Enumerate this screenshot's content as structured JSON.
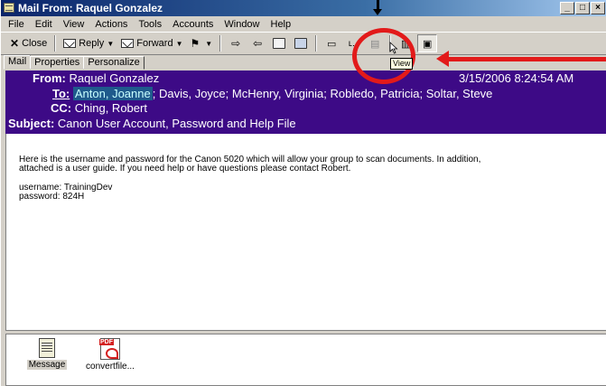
{
  "window": {
    "title": "Mail From: Raquel Gonzalez",
    "controls": [
      "_",
      "□",
      "×"
    ]
  },
  "menubar": [
    "File",
    "Edit",
    "View",
    "Actions",
    "Tools",
    "Accounts",
    "Window",
    "Help"
  ],
  "toolbar": {
    "close_label": "Close",
    "reply_label": "Reply",
    "forward_label": "Forward",
    "tooltip": "View"
  },
  "tabs": [
    "Mail",
    "Properties",
    "Personalize"
  ],
  "header": {
    "from_label": "From:",
    "from_value": "Raquel Gonzalez",
    "date": "3/15/2006 8:24:54 AM",
    "to_label": "To:",
    "to_first": "Anton, Joanne",
    "to_rest": "; Davis, Joyce; McHenry, Virginia; Robledo, Patricia; Soltar, Steve",
    "cc_label": "CC:",
    "cc_value": "Ching, Robert",
    "subject_label": "Subject:",
    "subject_value": "Canon User Account, Password and Help File",
    "bg_color": "#3d0a86"
  },
  "body": {
    "line1": "Here is the username and password for the Canon 5020  which will allow your group to scan documents.  In addition,",
    "line2": "attached is a user guide.  If you need help or have questions please contact Robert.",
    "line3": "username: TrainingDev",
    "line4": "password: 824H"
  },
  "attachments": [
    {
      "label": "Message",
      "icon": "message-icon"
    },
    {
      "label": "convertfile...",
      "icon": "pdf-icon"
    }
  ],
  "annotation_color": "#e21a1a"
}
